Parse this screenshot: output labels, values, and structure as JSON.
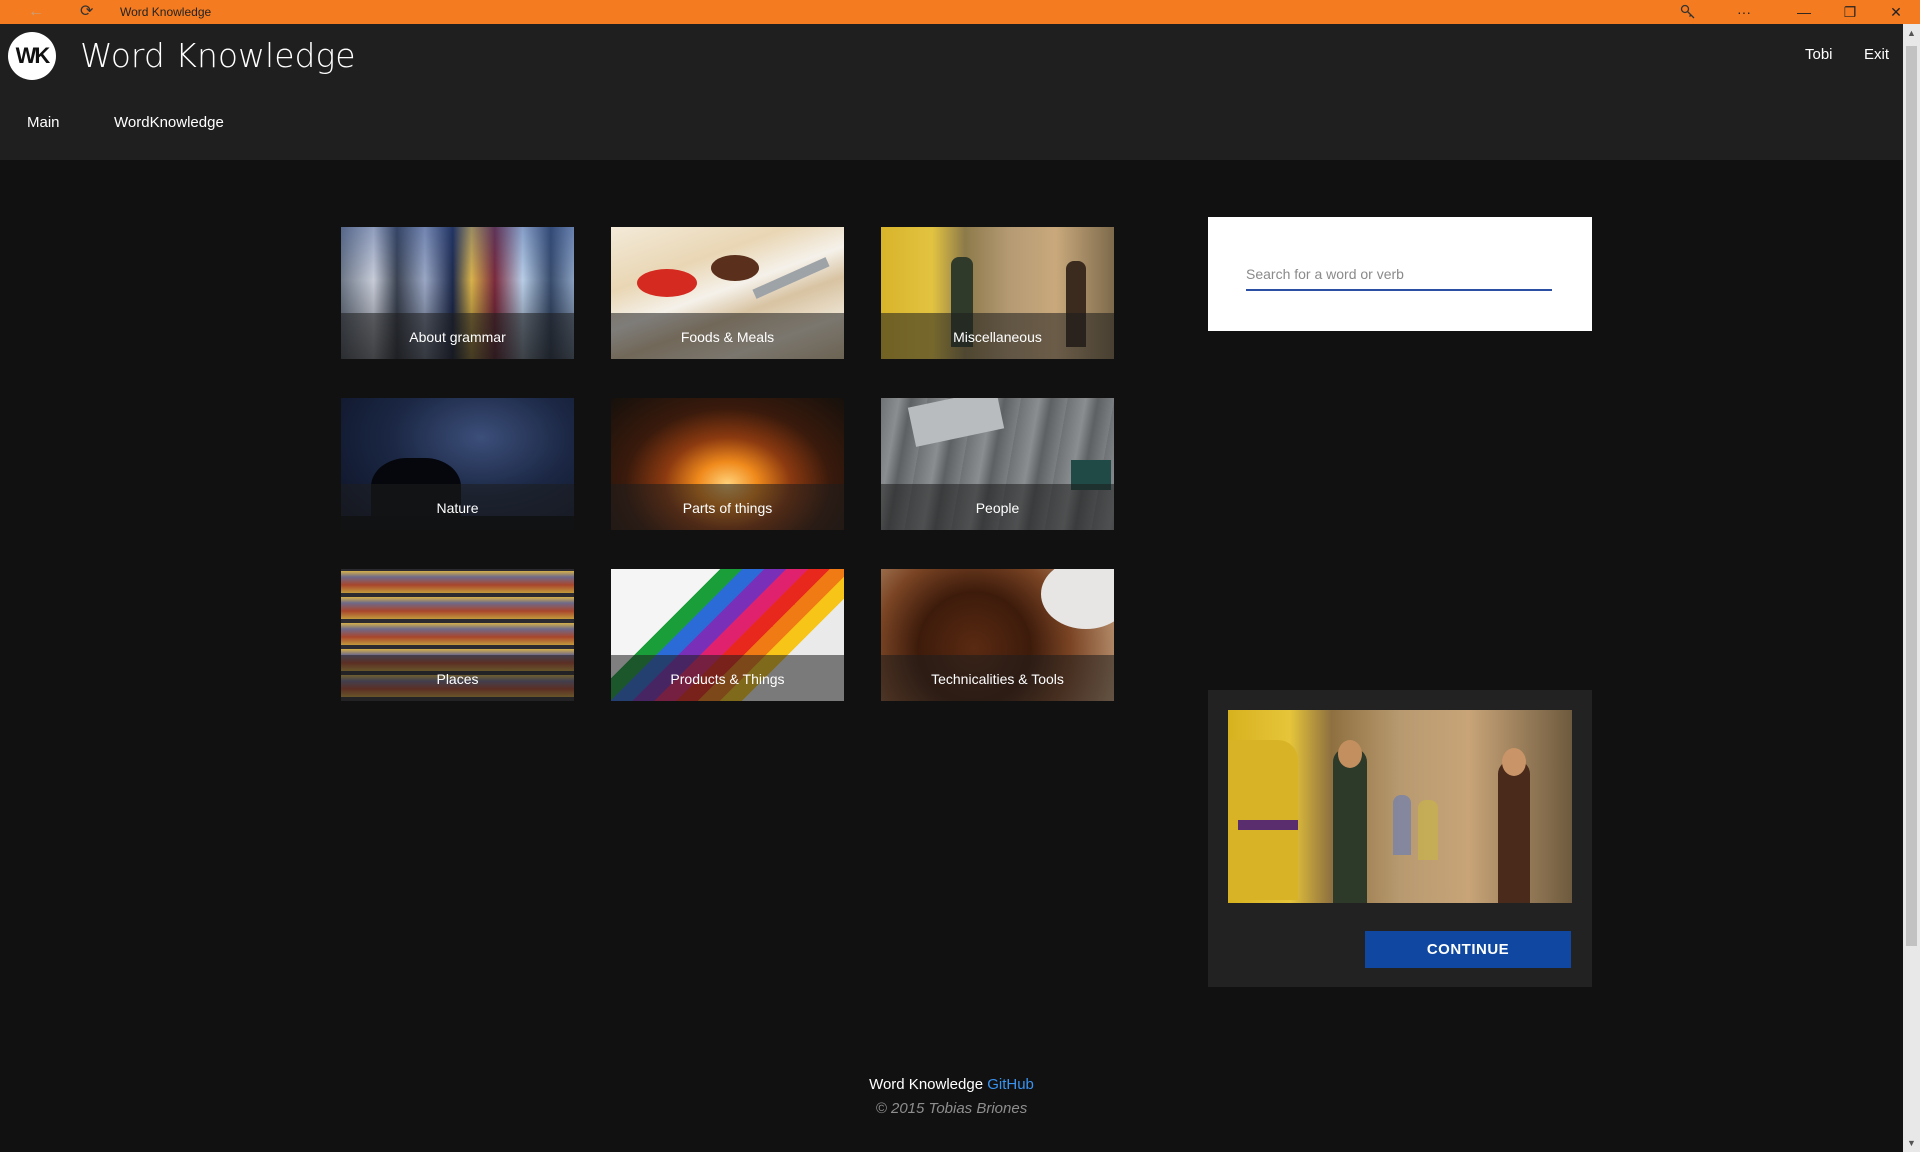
{
  "window": {
    "title": "Word Knowledge",
    "accent": "#F47B20",
    "controls": {
      "minimize": "—",
      "restore": "❐",
      "close": "✕",
      "more": "···"
    }
  },
  "header": {
    "logo_text": "WK",
    "title": "Word Knowledge",
    "user": "Tobi",
    "exit": "Exit",
    "nav": [
      "Main",
      "WordKnowledge"
    ]
  },
  "categories": [
    {
      "label": "About grammar",
      "icon": "city-street-photo"
    },
    {
      "label": "Foods & Meals",
      "icon": "crackers-and-dip-photo"
    },
    {
      "label": "Miscellaneous",
      "icon": "toy-figures-photo"
    },
    {
      "label": "Nature",
      "icon": "night-sky-photo"
    },
    {
      "label": "Parts of things",
      "icon": "campfire-photo"
    },
    {
      "label": "People",
      "icon": "wooden-desk-photo"
    },
    {
      "label": "Places",
      "icon": "shelves-photo"
    },
    {
      "label": "Products & Things",
      "icon": "colored-pencils-photo"
    },
    {
      "label": "Technicalities & Tools",
      "icon": "coffee-beans-photo"
    }
  ],
  "search": {
    "placeholder": "Search for a word or verb",
    "value": ""
  },
  "featured": {
    "button": "CONTINUE",
    "button_color": "#0f47a1"
  },
  "footer": {
    "name": "Word Knowledge",
    "link": "GitHub",
    "copyright": "© 2015 Tobias Briones"
  }
}
